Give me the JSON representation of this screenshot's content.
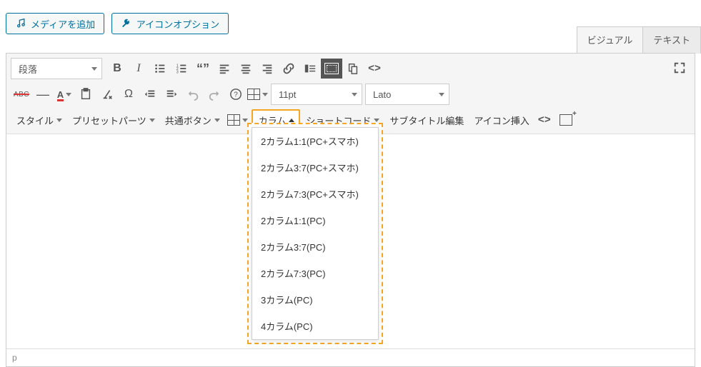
{
  "topbar": {
    "add_media_label": "メディアを追加",
    "icon_option_label": "アイコンオプション"
  },
  "tabs": {
    "visual": "ビジュアル",
    "text": "テキスト"
  },
  "toolbar": {
    "paragraph_label": "段落",
    "font_size_value": "11pt",
    "font_family_value": "Lato"
  },
  "third_row": {
    "style": "スタイル",
    "preset_parts": "プリセットパーツ",
    "common_button": "共通ボタン",
    "table_caret": "",
    "column": "カラム",
    "shortcode": "ショートコード",
    "subtitle_edit": "サブタイトル編集",
    "icon_insert": "アイコン挿入"
  },
  "column_menu": [
    "2カラム1:1(PC+スマホ)",
    "2カラム3:7(PC+スマホ)",
    "2カラム7:3(PC+スマホ)",
    "2カラム1:1(PC)",
    "2カラム3:7(PC)",
    "2カラム7:3(PC)",
    "3カラム(PC)",
    "4カラム(PC)"
  ],
  "statusbar": {
    "path": "p"
  }
}
